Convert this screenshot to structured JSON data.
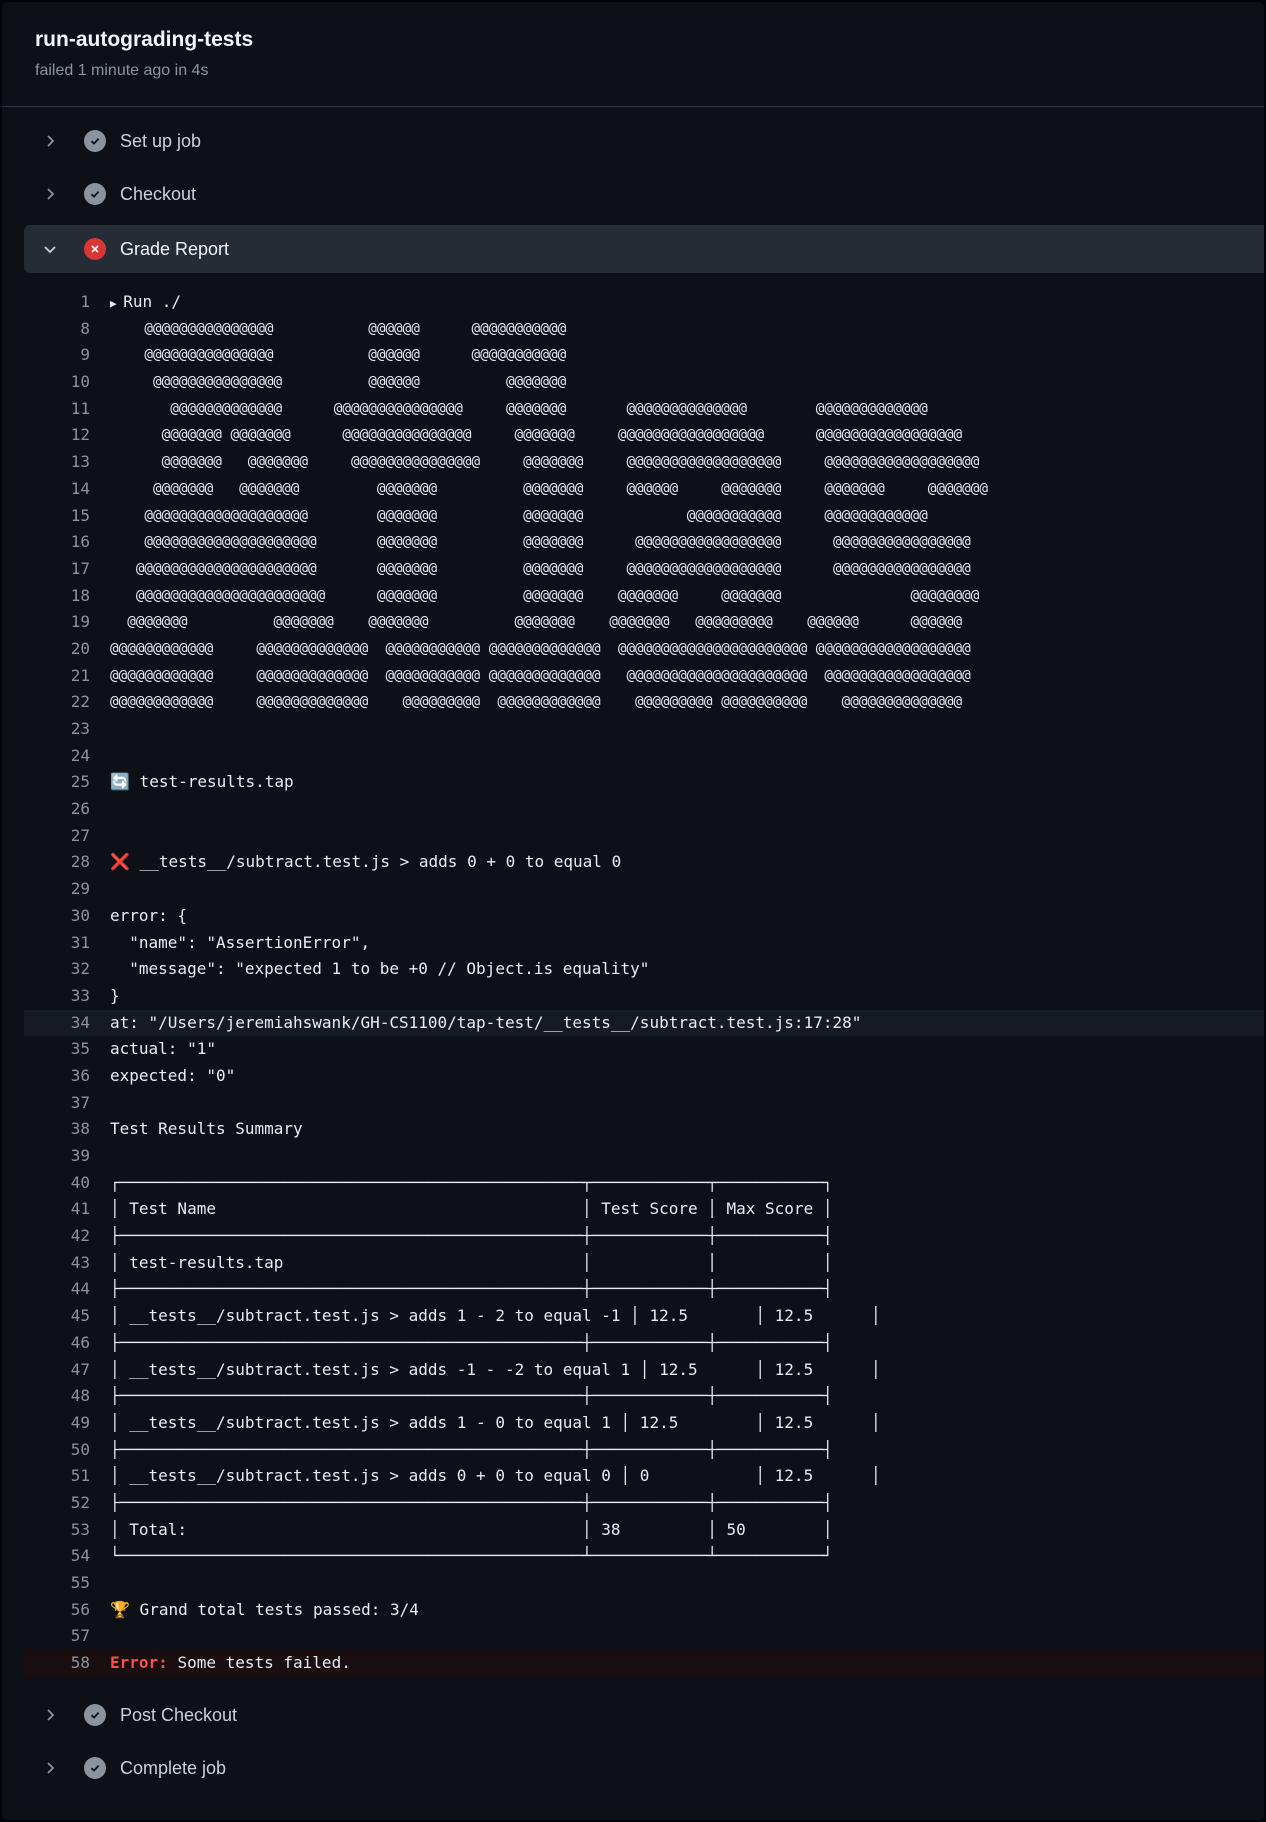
{
  "job": {
    "title": "run-autograding-tests",
    "status": "failed 1 minute ago in 4s"
  },
  "steps": {
    "setup": "Set up job",
    "checkout": "Checkout",
    "grade": "Grade Report",
    "post_checkout": "Post Checkout",
    "complete": "Complete job"
  },
  "log": [
    {
      "n": "1",
      "t": "Run ./"
    },
    {
      "n": "8",
      "t": "    @@@@@@@@@@@@@@@           @@@@@@      @@@@@@@@@@@"
    },
    {
      "n": "9",
      "t": "    @@@@@@@@@@@@@@@           @@@@@@      @@@@@@@@@@@"
    },
    {
      "n": "10",
      "t": "     @@@@@@@@@@@@@@@          @@@@@@          @@@@@@@"
    },
    {
      "n": "11",
      "t": "       @@@@@@@@@@@@@      @@@@@@@@@@@@@@@     @@@@@@@       @@@@@@@@@@@@@@        @@@@@@@@@@@@@"
    },
    {
      "n": "12",
      "t": "      @@@@@@@ @@@@@@@      @@@@@@@@@@@@@@@     @@@@@@@     @@@@@@@@@@@@@@@@@      @@@@@@@@@@@@@@@@@"
    },
    {
      "n": "13",
      "t": "      @@@@@@@   @@@@@@@     @@@@@@@@@@@@@@@     @@@@@@@     @@@@@@@@@@@@@@@@@@     @@@@@@@@@@@@@@@@@@"
    },
    {
      "n": "14",
      "t": "     @@@@@@@   @@@@@@@         @@@@@@@          @@@@@@@     @@@@@@     @@@@@@@     @@@@@@@     @@@@@@@"
    },
    {
      "n": "15",
      "t": "    @@@@@@@@@@@@@@@@@@@        @@@@@@@          @@@@@@@            @@@@@@@@@@@     @@@@@@@@@@@@"
    },
    {
      "n": "16",
      "t": "    @@@@@@@@@@@@@@@@@@@@       @@@@@@@          @@@@@@@      @@@@@@@@@@@@@@@@@      @@@@@@@@@@@@@@@@"
    },
    {
      "n": "17",
      "t": "   @@@@@@@@@@@@@@@@@@@@@       @@@@@@@          @@@@@@@     @@@@@@@@@@@@@@@@@@      @@@@@@@@@@@@@@@@"
    },
    {
      "n": "18",
      "t": "   @@@@@@@@@@@@@@@@@@@@@@      @@@@@@@          @@@@@@@    @@@@@@@     @@@@@@@               @@@@@@@@"
    },
    {
      "n": "19",
      "t": "  @@@@@@@          @@@@@@@    @@@@@@@          @@@@@@@    @@@@@@@   @@@@@@@@@    @@@@@@      @@@@@@"
    },
    {
      "n": "20",
      "t": "@@@@@@@@@@@@     @@@@@@@@@@@@@  @@@@@@@@@@@ @@@@@@@@@@@@@  @@@@@@@@@@@@@@@@@@@@@@ @@@@@@@@@@@@@@@@@@"
    },
    {
      "n": "21",
      "t": "@@@@@@@@@@@@     @@@@@@@@@@@@@  @@@@@@@@@@@ @@@@@@@@@@@@@   @@@@@@@@@@@@@@@@@@@@@  @@@@@@@@@@@@@@@@@"
    },
    {
      "n": "22",
      "t": "@@@@@@@@@@@@     @@@@@@@@@@@@@    @@@@@@@@@  @@@@@@@@@@@@    @@@@@@@@@ @@@@@@@@@@    @@@@@@@@@@@@@@"
    },
    {
      "n": "23",
      "t": ""
    },
    {
      "n": "24",
      "t": ""
    },
    {
      "n": "25",
      "t": "🔄 test-results.tap"
    },
    {
      "n": "26",
      "t": ""
    },
    {
      "n": "27",
      "t": ""
    },
    {
      "n": "28",
      "t": "❌ __tests__/subtract.test.js > adds 0 + 0 to equal 0"
    },
    {
      "n": "29",
      "t": ""
    },
    {
      "n": "30",
      "t": "error: {"
    },
    {
      "n": "31",
      "t": "  \"name\": \"AssertionError\","
    },
    {
      "n": "32",
      "t": "  \"message\": \"expected 1 to be +0 // Object.is equality\""
    },
    {
      "n": "33",
      "t": "}"
    },
    {
      "n": "34",
      "t": "at: \"/Users/jeremiahswank/GH-CS1100/tap-test/__tests__/subtract.test.js:17:28\""
    },
    {
      "n": "35",
      "t": "actual: \"1\""
    },
    {
      "n": "36",
      "t": "expected: \"0\""
    },
    {
      "n": "37",
      "t": ""
    },
    {
      "n": "38",
      "t": "Test Results Summary"
    },
    {
      "n": "39",
      "t": ""
    },
    {
      "n": "40",
      "t": "┌────────────────────────────────────────────────┬────────────┬───────────┐"
    },
    {
      "n": "41",
      "t": "│ Test Name                                      │ Test Score │ Max Score │"
    },
    {
      "n": "42",
      "t": "├────────────────────────────────────────────────┼────────────┼───────────┤"
    },
    {
      "n": "43",
      "t": "│ test-results.tap                               │            │           │"
    },
    {
      "n": "44",
      "t": "├────────────────────────────────────────────────┼────────────┼───────────┤"
    },
    {
      "n": "45",
      "t": "│ __tests__/subtract.test.js > adds 1 - 2 to equal -1 │ 12.5       │ 12.5      │"
    },
    {
      "n": "46",
      "t": "├────────────────────────────────────────────────┼────────────┼───────────┤"
    },
    {
      "n": "47",
      "t": "│ __tests__/subtract.test.js > adds -1 - -2 to equal 1 │ 12.5      │ 12.5      │"
    },
    {
      "n": "48",
      "t": "├────────────────────────────────────────────────┼────────────┼───────────┤"
    },
    {
      "n": "49",
      "t": "│ __tests__/subtract.test.js > adds 1 - 0 to equal 1 │ 12.5        │ 12.5      │"
    },
    {
      "n": "50",
      "t": "├────────────────────────────────────────────────┼────────────┼───────────┤"
    },
    {
      "n": "51",
      "t": "│ __tests__/subtract.test.js > adds 0 + 0 to equal 0 │ 0           │ 12.5      │"
    },
    {
      "n": "52",
      "t": "├────────────────────────────────────────────────┼────────────┼───────────┤"
    },
    {
      "n": "53",
      "t": "│ Total:                                         │ 38         │ 50        │"
    },
    {
      "n": "54",
      "t": "└────────────────────────────────────────────────┴────────────┴───────────┘"
    },
    {
      "n": "55",
      "t": ""
    },
    {
      "n": "56",
      "t": "🏆 Grand total tests passed: 3/4"
    },
    {
      "n": "57",
      "t": ""
    },
    {
      "n": "58",
      "t": "Some tests failed."
    }
  ],
  "error_prefix": "Error:",
  "colors": {
    "fail": "#da3633",
    "ok": "#8b949e",
    "accent": "#39c5cf",
    "error_text": "#f85149"
  }
}
